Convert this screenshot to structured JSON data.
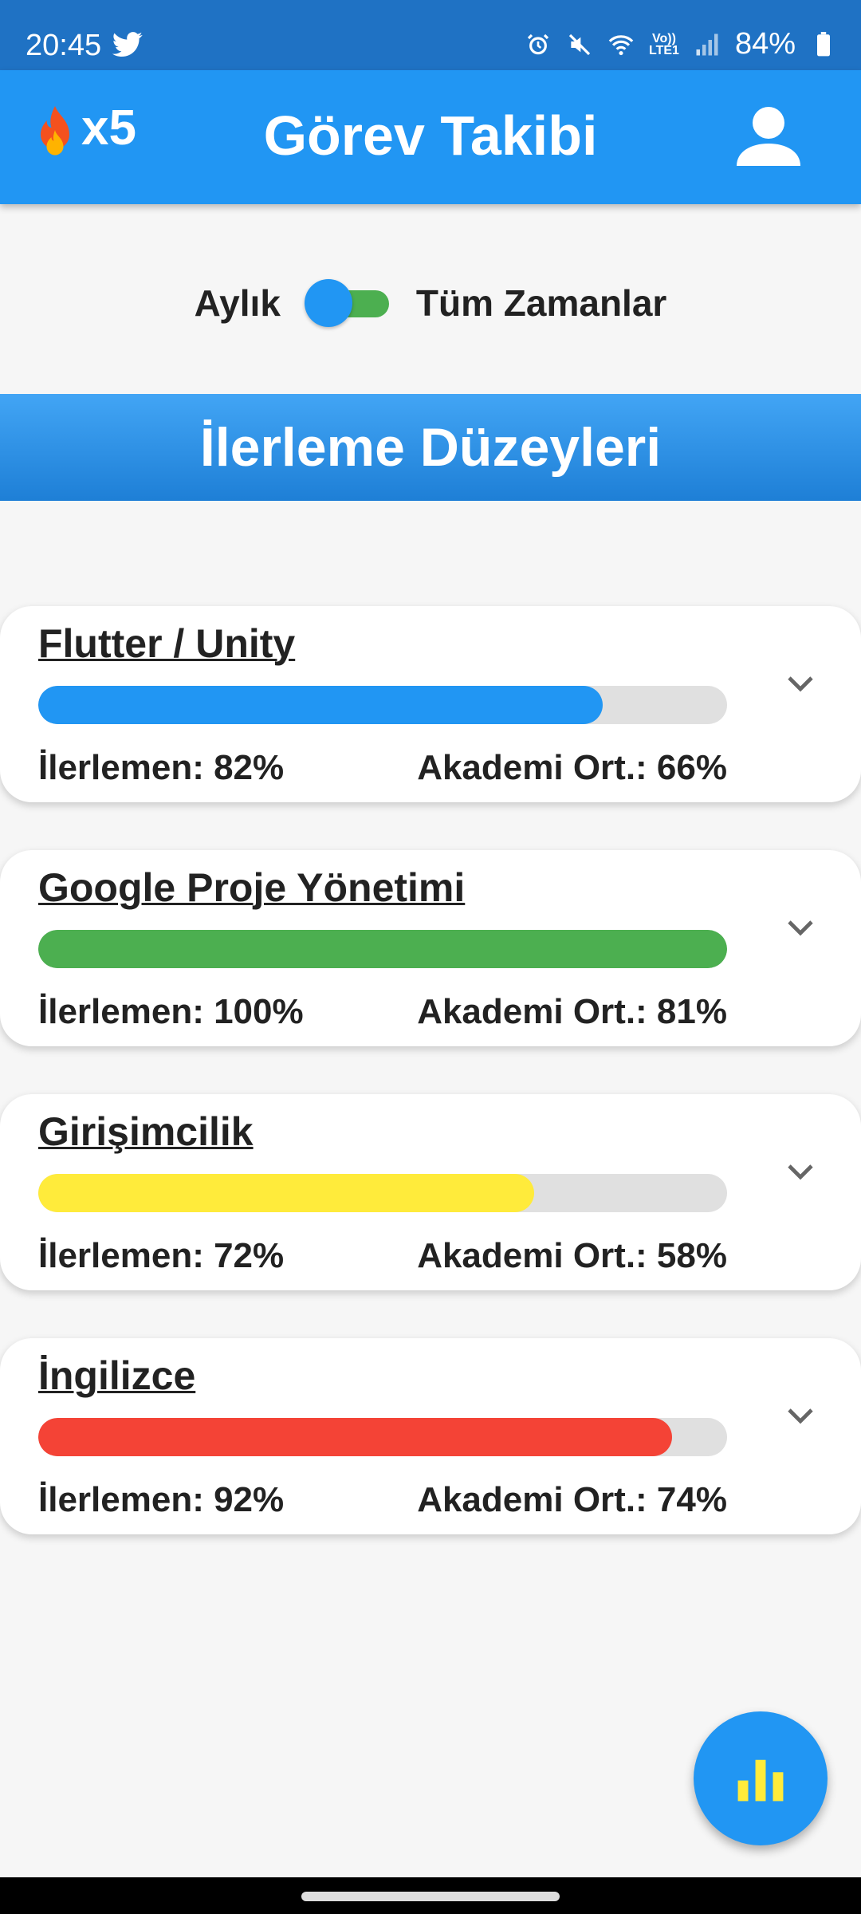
{
  "status_bar": {
    "time": "20:45",
    "battery": "84%",
    "volte_top": "Vo))",
    "volte_bottom": "LTE1",
    "icons": [
      "twitter-icon",
      "alarm-icon",
      "mute-icon",
      "wifi-icon",
      "volte-icon",
      "signal-icon",
      "battery-icon"
    ]
  },
  "app_bar": {
    "streak_count": "x5",
    "title": "Görev Takibi",
    "icons": [
      "flame-icon",
      "person-icon"
    ]
  },
  "toggle": {
    "left_label": "Aylık",
    "right_label": "Tüm Zamanlar"
  },
  "section": {
    "title": "İlerleme Düzeyleri"
  },
  "courses": [
    {
      "title": "Flutter / Unity",
      "progress": 0.82,
      "color": "#2196f3",
      "progress_text": "İlerlemen: 82%",
      "average_text": "Akademi Ort.: 66%"
    },
    {
      "title": "Google Proje Yönetimi",
      "progress": 1.0,
      "color": "#4caf50",
      "progress_text": "İlerlemen: 100%",
      "average_text": "Akademi Ort.: 81%"
    },
    {
      "title": "Girişimcilik",
      "progress": 0.72,
      "color": "#ffeb3b",
      "progress_text": "İlerlemen: 72%",
      "average_text": "Akademi Ort.: 58%"
    },
    {
      "title": "İngilizce",
      "progress": 0.92,
      "color": "#f44336",
      "progress_text": "İlerlemen: 92%",
      "average_text": "Akademi Ort.: 74%"
    }
  ],
  "fab": {
    "icon": "bar-chart-icon"
  },
  "colors": {
    "status_bar": "#1f72c4",
    "app_bar": "#2196f3",
    "switch_track": "#4caf50",
    "background": "#f6f6f6",
    "fab_icon": "#ffeb3b"
  }
}
